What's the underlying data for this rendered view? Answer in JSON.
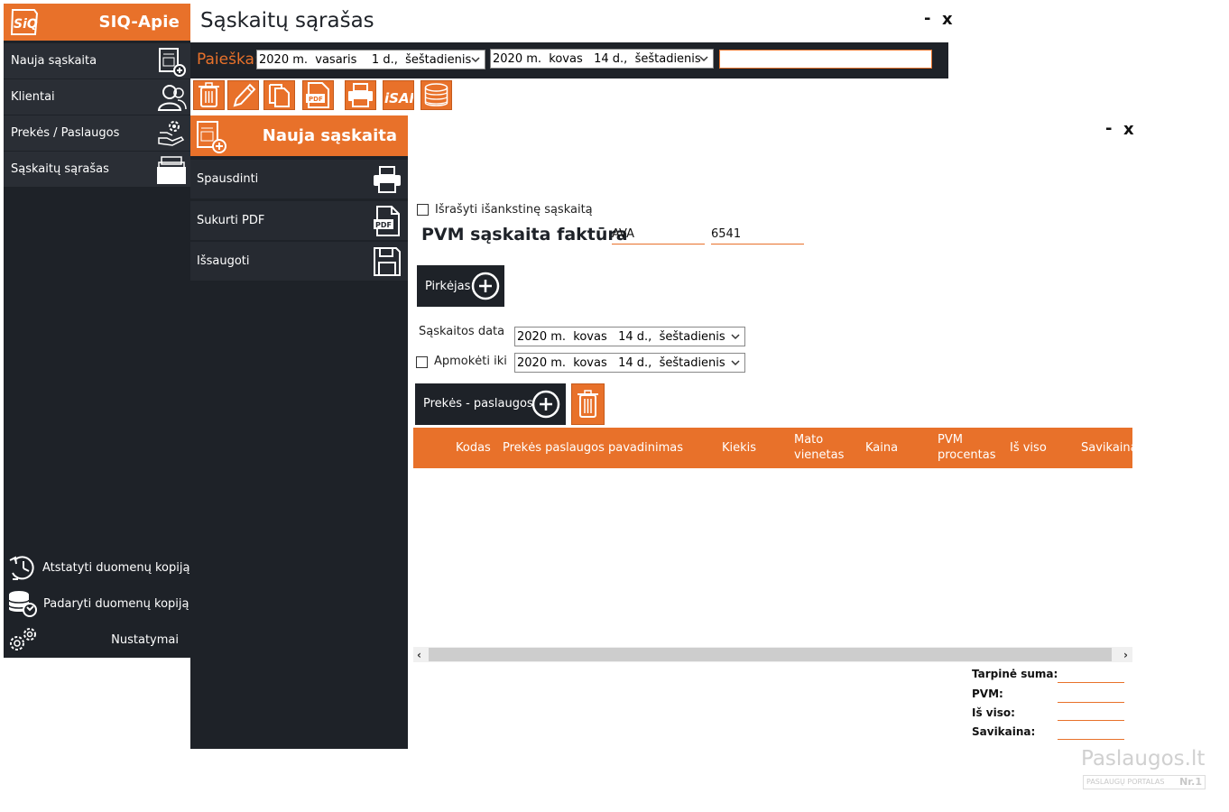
{
  "app": {
    "name": "SIQ-Apie",
    "logo_text": "SiQ"
  },
  "sidebar": {
    "items": [
      {
        "label": "Nauja sąskaita",
        "icon": "new-invoice-icon"
      },
      {
        "label": "Klientai",
        "icon": "clients-icon"
      },
      {
        "label": "Prekės / Paslaugos",
        "icon": "products-services-icon"
      },
      {
        "label": "Sąskaitų sąrašas",
        "icon": "invoice-list-icon"
      }
    ],
    "bottom": [
      {
        "label": "Atstatyti duomenų kopiją",
        "icon": "restore-backup-icon"
      },
      {
        "label": "Padaryti duomenų kopiją",
        "icon": "create-backup-icon"
      },
      {
        "label": "Nustatymai",
        "icon": "settings-icon"
      }
    ]
  },
  "window": {
    "title": "Sąskaitų sąrašas",
    "minimize": "-",
    "close": "x"
  },
  "search": {
    "label": "Paieška:",
    "date_from": "2020 m.  vasaris    1 d.,  šeštadienis",
    "date_to": "2020 m.  kovas   14 d.,  šeštadienis",
    "text_value": ""
  },
  "toolbar": {
    "buttons": [
      "delete-icon",
      "edit-icon",
      "copy-icon",
      "pdf-icon",
      "print-icon",
      "isaf-icon",
      "coins-icon"
    ],
    "isaf_text": "iSAF"
  },
  "new_invoice_panel": {
    "title": "Nauja sąskaita",
    "minimize": "-",
    "close": "x",
    "actions": [
      {
        "label": "Spausdinti",
        "icon": "printer-icon"
      },
      {
        "label": "Sukurti PDF",
        "icon": "pdf-file-icon"
      },
      {
        "label": "Išsaugoti",
        "icon": "save-icon"
      }
    ]
  },
  "invoice_form": {
    "advance_checkbox_label": "Išrašyti išankstinę sąskaitą",
    "advance_checked": false,
    "heading": "PVM sąskaita faktūra",
    "series": "AVA",
    "number": "6541",
    "buyer_button": "Pirkėjas",
    "invoice_date_label": "Sąskaitos data",
    "invoice_date": "2020 m.  kovas   14 d.,  šeštadienis",
    "pay_until_label": "Apmokėti iki",
    "pay_until_checked": false,
    "pay_until_date": "2020 m.  kovas   14 d.,  šeštadienis",
    "items_button": "Prekės - paslaugos"
  },
  "items_table": {
    "columns": [
      "Kodas",
      "Prekės paslaugos pavadinimas",
      "Kiekis",
      "Mato vienetas",
      "Kaina",
      "PVM procentas",
      "Iš viso",
      "Savikaina"
    ],
    "column_lines": [
      [
        "Kodas"
      ],
      [
        "Prekės paslaugos pavadinimas"
      ],
      [
        "Kiekis"
      ],
      [
        "Mato",
        "vienetas"
      ],
      [
        "Kaina"
      ],
      [
        "PVM",
        "procentas"
      ],
      [
        "Iš viso"
      ],
      [
        "Savikaina"
      ]
    ],
    "rows": []
  },
  "totals": {
    "subtotal_label": "Tarpinė suma:",
    "vat_label": "PVM:",
    "total_label": "Iš viso:",
    "cost_label": "Savikaina:"
  },
  "watermark": {
    "name": "Paslaugos.lt",
    "subtitle": "PASLAUGŲ PORTALAS",
    "badge": "Nr.1"
  },
  "colors": {
    "accent": "#e8712a",
    "dark": "#1e2228",
    "dark_item": "#2a2e35"
  }
}
